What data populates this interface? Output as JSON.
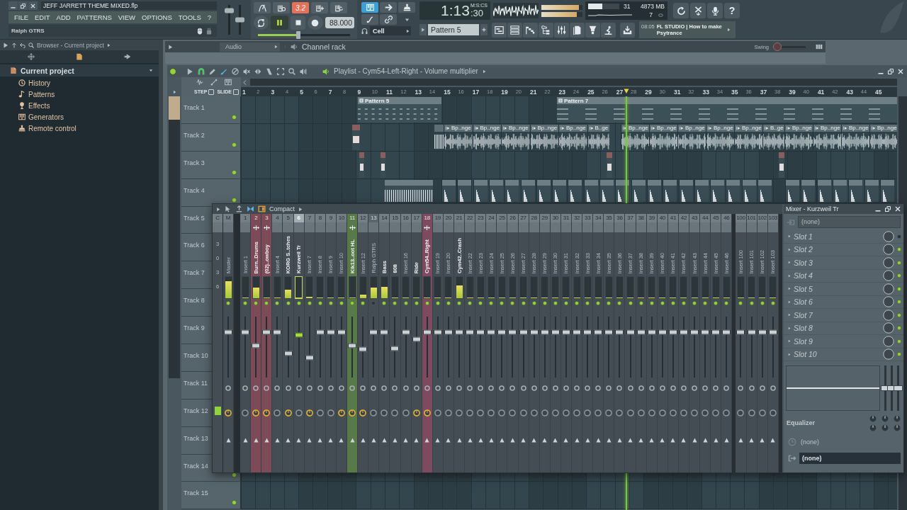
{
  "window": {
    "title": "JEFF JARRETT THEME MIXED.flp"
  },
  "menu": [
    "FILE",
    "EDIT",
    "ADD",
    "PATTERNS",
    "VIEW",
    "OPTIONS",
    "TOOLS",
    "?"
  ],
  "hint": "Ralph GTRS",
  "master_sliders": [
    {
      "level": 0.8
    },
    {
      "level": 0.5
    }
  ],
  "transport": {
    "toggles": [
      {
        "kind": "metronome",
        "on": false
      },
      {
        "kind": "wait",
        "on": false
      },
      {
        "kind": "countdown",
        "label": "3.2",
        "on": true
      },
      {
        "kind": "step",
        "on": false
      },
      {
        "kind": "blend",
        "on": false
      }
    ],
    "playing": true,
    "recording": false,
    "tempo": "88.000",
    "position": {
      "level": 0.44
    }
  },
  "recording_tools": [
    {
      "kind": "keyboard",
      "on": true
    },
    {
      "kind": "arrow",
      "on": false
    },
    {
      "kind": "stamp",
      "on": false
    },
    {
      "kind": "curve",
      "on": false
    },
    {
      "kind": "link",
      "on": false
    }
  ],
  "snap": "Cell",
  "time": {
    "main": "1:13",
    "fraction": ":30",
    "unit": "M:S:CS"
  },
  "output_meters": [
    {
      "level": 0.92
    },
    {
      "level": 0.86
    }
  ],
  "cpu": {
    "level": 0.45,
    "reading": "31",
    "memory": "4873 MB",
    "polyphony": "7"
  },
  "help_label": "?",
  "pattern": "Pattern 5",
  "news": {
    "time": "08:05",
    "title": "FL STUDIO | How to make Psytrance"
  },
  "browser": {
    "title": "Browser - Current project",
    "tree": [
      {
        "label": "Current project",
        "expanded": true,
        "children": [
          {
            "label": "History"
          },
          {
            "label": "Patterns"
          },
          {
            "label": "Effects"
          },
          {
            "label": "Generators"
          },
          {
            "label": "Remote control"
          }
        ]
      }
    ]
  },
  "channel_rack": {
    "filter": "Audio",
    "title": "Channel rack",
    "swing": {
      "label": "Swing",
      "level": 0.05
    }
  },
  "playlist": {
    "title": "Playlist - Cym54-Left-Right - Volume multiplier",
    "step": {
      "label": "STEP",
      "checked": false
    },
    "slide": {
      "label": "SLIDE",
      "checked": false
    },
    "bars": [
      "1",
      "2",
      "3",
      "4",
      "5",
      "6",
      "7",
      "8",
      "9",
      "10",
      "11",
      "12",
      "13",
      "14",
      "15",
      "16",
      "17",
      "18",
      "19",
      "20",
      "21",
      "22",
      "23",
      "24",
      "25",
      "26",
      "27",
      "28",
      "29",
      "30",
      "31",
      "32",
      "33",
      "34",
      "35",
      "36",
      "37",
      "38",
      "39",
      "40",
      "41",
      "42",
      "43",
      "44",
      "45"
    ],
    "tracks": [
      {
        "name": "Track 1",
        "clips": [
          {
            "kind": "pattern",
            "label": "Pattern 5"
          },
          {
            "kind": "pattern",
            "label": "Pattern 7"
          }
        ]
      },
      {
        "name": "Track 2",
        "clips": [
          {
            "kind": "audio",
            "label": "Bp..nge"
          },
          {
            "kind": "audio",
            "label": "Bp..nge"
          },
          {
            "kind": "audio",
            "label": "Bp..nge"
          },
          {
            "kind": "audio",
            "label": "Bp..nge"
          },
          {
            "kind": "audio",
            "label": "Bp..nge"
          },
          {
            "kind": "audio",
            "label": "B..ge"
          },
          {
            "kind": "audio",
            "label": "Bp..nge"
          },
          {
            "kind": "audio",
            "label": "Bp..nge"
          },
          {
            "kind": "audio",
            "label": "Bp..nge"
          },
          {
            "kind": "audio",
            "label": "Bp..nge"
          },
          {
            "kind": "audio",
            "label": "Bp..nge"
          },
          {
            "kind": "audio",
            "label": "B..ge"
          },
          {
            "kind": "audio",
            "label": "Bp..nge"
          },
          {
            "kind": "audio",
            "label": "Bp..nge"
          },
          {
            "kind": "audio",
            "label": "Bp..nge"
          },
          {
            "kind": "audio",
            "label": "Bp..nge"
          }
        ]
      },
      {
        "name": "Track 3"
      },
      {
        "name": "Track 4"
      },
      {
        "name": "Track 5"
      },
      {
        "name": "Track 6"
      },
      {
        "name": "Track 7"
      },
      {
        "name": "Track 8"
      },
      {
        "name": "Track 9"
      },
      {
        "name": "Track 10"
      },
      {
        "name": "Track 11"
      },
      {
        "name": "Track 12"
      },
      {
        "name": "Track 13"
      },
      {
        "name": "Track 14"
      },
      {
        "name": "Track 15"
      }
    ]
  },
  "mixer": {
    "view": "Compact",
    "title": "Mixer - Kurzweil Tr",
    "current_label": "C",
    "scale": [
      "3",
      "0",
      "3",
      "6"
    ],
    "channels": [
      {
        "number": "M",
        "name": "Master",
        "dimmed": true,
        "selected": false,
        "muted": false,
        "routed": false,
        "send": true,
        "level": 0.8,
        "fader": {
          "level": 0.75
        }
      },
      {
        "number": "1",
        "name": "Insert 1",
        "dimmed": true,
        "selected": false,
        "muted": false,
        "routed": false,
        "send": false,
        "level": 0,
        "fader": {
          "level": 0.75
        }
      },
      {
        "number": "2",
        "name": "Burn..Drums",
        "dimmed": false,
        "selected": false,
        "muted": false,
        "routed": true,
        "send": true,
        "level": 0.5,
        "fader": {
          "level": 0.52
        },
        "color": "#7d4a58"
      },
      {
        "number": "3",
        "name": "(02)..owboy",
        "dimmed": false,
        "selected": false,
        "muted": false,
        "routed": true,
        "send": true,
        "level": 0,
        "fader": {
          "level": 0.75
        },
        "color": "#7d4a58"
      },
      {
        "number": "4",
        "name": "Insert 4",
        "dimmed": true,
        "selected": false,
        "muted": false,
        "routed": false,
        "send": false,
        "level": 0,
        "fader": {
          "level": 0.75
        }
      },
      {
        "number": "5",
        "name": "KORG S..tches",
        "dimmed": false,
        "selected": false,
        "muted": false,
        "routed": false,
        "send": true,
        "level": 0.4,
        "fader": {
          "level": 0.4
        }
      },
      {
        "number": "6",
        "name": "Kurzweil Tr",
        "dimmed": false,
        "selected": true,
        "muted": false,
        "routed": false,
        "send": false,
        "level": 0,
        "fader": {
          "level": 0.7
        }
      },
      {
        "number": "7",
        "name": "Insert 7",
        "dimmed": true,
        "selected": false,
        "muted": false,
        "routed": false,
        "send": true,
        "level": 0.08,
        "fader": {
          "level": 0.33
        }
      },
      {
        "number": "8",
        "name": "Insert 8",
        "dimmed": true,
        "selected": false,
        "muted": false,
        "routed": false,
        "send": false,
        "level": 0,
        "fader": {
          "level": 0.75
        }
      },
      {
        "number": "9",
        "name": "Insert 9",
        "dimmed": true,
        "selected": false,
        "muted": false,
        "routed": false,
        "send": false,
        "level": 0,
        "fader": {
          "level": 0.75
        }
      },
      {
        "number": "10",
        "name": "Insert 10",
        "dimmed": true,
        "selected": false,
        "muted": false,
        "routed": false,
        "send": true,
        "level": 0,
        "fader": {
          "level": 0.75
        }
      },
      {
        "number": "11",
        "name": "Kik13..oot HL",
        "dimmed": false,
        "selected": false,
        "muted": false,
        "routed": true,
        "send": true,
        "level": 0,
        "fader": {
          "level": 0.52
        },
        "color": "#587a48"
      },
      {
        "number": "12",
        "name": "Insert 12",
        "dimmed": true,
        "selected": false,
        "muted": false,
        "routed": false,
        "send": true,
        "level": 0.18,
        "fader": {
          "level": 0.46
        }
      },
      {
        "number": "13",
        "name": "Ralph GTRS",
        "dimmed": true,
        "selected": false,
        "muted": true,
        "routed": false,
        "send": false,
        "level": 0.5,
        "fader": {
          "level": 0.75
        }
      },
      {
        "number": "14",
        "name": "Bass",
        "dimmed": false,
        "selected": false,
        "muted": false,
        "routed": false,
        "send": false,
        "level": 0.55,
        "fader": {
          "level": 0.75
        }
      },
      {
        "number": "15",
        "name": "808",
        "dimmed": false,
        "selected": false,
        "muted": false,
        "routed": false,
        "send": false,
        "level": 0,
        "fader": {
          "level": 0.48
        }
      },
      {
        "number": "16",
        "name": "Insert 16",
        "dimmed": true,
        "selected": false,
        "muted": false,
        "routed": false,
        "send": false,
        "level": 0,
        "fader": {
          "level": 0.75
        }
      },
      {
        "number": "17",
        "name": "Ride",
        "dimmed": false,
        "selected": false,
        "muted": false,
        "routed": false,
        "send": true,
        "level": 0,
        "fader": {
          "level": 0.63
        }
      },
      {
        "number": "18",
        "name": "Cym54..Right",
        "dimmed": false,
        "selected": false,
        "muted": false,
        "routed": true,
        "send": true,
        "level": 0,
        "fader": {
          "level": 0.75
        },
        "color": "#7e4a60"
      },
      {
        "number": "19",
        "name": "Insert 19",
        "dimmed": true,
        "selected": false,
        "muted": false,
        "routed": false,
        "send": false,
        "level": 0,
        "fader": {
          "level": 0.75
        }
      },
      {
        "number": "20",
        "name": "Insert 20",
        "dimmed": true,
        "selected": false,
        "muted": false,
        "routed": false,
        "send": false,
        "level": 0,
        "fader": {
          "level": 0.75
        }
      },
      {
        "number": "21",
        "name": "Cym42..Crash",
        "dimmed": false,
        "selected": false,
        "muted": false,
        "routed": false,
        "send": false,
        "level": 0.6,
        "fader": {
          "level": 0.75
        }
      },
      {
        "number": "22",
        "name": "Insert 22",
        "dimmed": true,
        "selected": false,
        "muted": false,
        "routed": false,
        "send": false,
        "level": 0,
        "fader": {
          "level": 0.75
        }
      },
      {
        "number": "23",
        "name": "Insert 23",
        "dimmed": true,
        "selected": false,
        "muted": false,
        "routed": false,
        "send": false,
        "level": 0,
        "fader": {
          "level": 0.75
        }
      },
      {
        "number": "24",
        "name": "Insert 24",
        "dimmed": true,
        "selected": false,
        "muted": false,
        "routed": false,
        "send": false,
        "level": 0,
        "fader": {
          "level": 0.75
        }
      },
      {
        "number": "25",
        "name": "Insert 25",
        "dimmed": true,
        "selected": false,
        "muted": false,
        "routed": false,
        "send": false,
        "level": 0,
        "fader": {
          "level": 0.75
        }
      },
      {
        "number": "26",
        "name": "Insert 26",
        "dimmed": true,
        "selected": false,
        "muted": false,
        "routed": false,
        "send": false,
        "level": 0,
        "fader": {
          "level": 0.75
        }
      },
      {
        "number": "27",
        "name": "Insert 27",
        "dimmed": true,
        "selected": false,
        "muted": false,
        "routed": false,
        "send": false,
        "level": 0,
        "fader": {
          "level": 0.75
        }
      },
      {
        "number": "28",
        "name": "Insert 28",
        "dimmed": true,
        "selected": false,
        "muted": false,
        "routed": false,
        "send": false,
        "level": 0,
        "fader": {
          "level": 0.75
        }
      },
      {
        "number": "29",
        "name": "Insert 29",
        "dimmed": true,
        "selected": false,
        "muted": false,
        "routed": false,
        "send": false,
        "level": 0,
        "fader": {
          "level": 0.75
        }
      },
      {
        "number": "30",
        "name": "Insert 30",
        "dimmed": true,
        "selected": false,
        "muted": false,
        "routed": false,
        "send": false,
        "level": 0,
        "fader": {
          "level": 0.75
        }
      },
      {
        "number": "31",
        "name": "Insert 31",
        "dimmed": true,
        "selected": false,
        "muted": false,
        "routed": false,
        "send": false,
        "level": 0,
        "fader": {
          "level": 0.75
        }
      },
      {
        "number": "32",
        "name": "Insert 32",
        "dimmed": true,
        "selected": false,
        "muted": false,
        "routed": false,
        "send": false,
        "level": 0,
        "fader": {
          "level": 0.75
        }
      },
      {
        "number": "33",
        "name": "Insert 33",
        "dimmed": true,
        "selected": false,
        "muted": false,
        "routed": false,
        "send": false,
        "level": 0,
        "fader": {
          "level": 0.75
        }
      },
      {
        "number": "34",
        "name": "Insert 34",
        "dimmed": true,
        "selected": false,
        "muted": false,
        "routed": false,
        "send": false,
        "level": 0,
        "fader": {
          "level": 0.75
        }
      },
      {
        "number": "35",
        "name": "Insert 35",
        "dimmed": true,
        "selected": false,
        "muted": false,
        "routed": false,
        "send": false,
        "level": 0,
        "fader": {
          "level": 0.75
        }
      },
      {
        "number": "36",
        "name": "Insert 36",
        "dimmed": true,
        "selected": false,
        "muted": false,
        "routed": false,
        "send": false,
        "level": 0,
        "fader": {
          "level": 0.75
        }
      },
      {
        "number": "37",
        "name": "Insert 37",
        "dimmed": true,
        "selected": false,
        "muted": false,
        "routed": false,
        "send": false,
        "level": 0,
        "fader": {
          "level": 0.75
        }
      },
      {
        "number": "38",
        "name": "Insert 38",
        "dimmed": true,
        "selected": false,
        "muted": false,
        "routed": false,
        "send": false,
        "level": 0,
        "fader": {
          "level": 0.75
        }
      },
      {
        "number": "39",
        "name": "Insert 39",
        "dimmed": true,
        "selected": false,
        "muted": false,
        "routed": false,
        "send": false,
        "level": 0,
        "fader": {
          "level": 0.75
        }
      },
      {
        "number": "40",
        "name": "Insert 40",
        "dimmed": true,
        "selected": false,
        "muted": false,
        "routed": false,
        "send": false,
        "level": 0,
        "fader": {
          "level": 0.75
        }
      },
      {
        "number": "41",
        "name": "Insert 41",
        "dimmed": true,
        "selected": false,
        "muted": false,
        "routed": false,
        "send": false,
        "level": 0,
        "fader": {
          "level": 0.75
        }
      },
      {
        "number": "42",
        "name": "Insert 42",
        "dimmed": true,
        "selected": false,
        "muted": false,
        "routed": false,
        "send": false,
        "level": 0,
        "fader": {
          "level": 0.75
        }
      },
      {
        "number": "43",
        "name": "Insert 43",
        "dimmed": true,
        "selected": false,
        "muted": false,
        "routed": false,
        "send": false,
        "level": 0,
        "fader": {
          "level": 0.75
        }
      },
      {
        "number": "44",
        "name": "Insert 44",
        "dimmed": true,
        "selected": false,
        "muted": false,
        "routed": false,
        "send": false,
        "level": 0,
        "fader": {
          "level": 0.75
        }
      },
      {
        "number": "45",
        "name": "Insert 45",
        "dimmed": true,
        "selected": false,
        "muted": false,
        "routed": false,
        "send": false,
        "level": 0,
        "fader": {
          "level": 0.75
        }
      },
      {
        "number": "46",
        "name": "Insert 46",
        "dimmed": true,
        "selected": false,
        "muted": false,
        "routed": false,
        "send": false,
        "level": 0,
        "fader": {
          "level": 0.75
        }
      },
      {
        "number": "100",
        "name": "Insert 100",
        "dimmed": true,
        "selected": false,
        "muted": false,
        "routed": false,
        "send": false,
        "level": 0,
        "fader": {
          "level": 0.75
        }
      },
      {
        "number": "101",
        "name": "Insert 101",
        "dimmed": true,
        "selected": false,
        "muted": false,
        "routed": false,
        "send": false,
        "level": 0,
        "fader": {
          "level": 0.75
        }
      },
      {
        "number": "102",
        "name": "Insert 102",
        "dimmed": true,
        "selected": false,
        "muted": false,
        "routed": false,
        "send": false,
        "level": 0,
        "fader": {
          "level": 0.75
        }
      },
      {
        "number": "103",
        "name": "Insert 103",
        "dimmed": true,
        "selected": false,
        "muted": false,
        "routed": false,
        "send": false,
        "level": 0,
        "fader": {
          "level": 0.75
        }
      }
    ],
    "input": "(none)",
    "slots": [
      {
        "label": "Slot 1",
        "on": false
      },
      {
        "label": "Slot 2",
        "on": true
      },
      {
        "label": "Slot 3",
        "on": true
      },
      {
        "label": "Slot 4",
        "on": true
      },
      {
        "label": "Slot 5",
        "on": true
      },
      {
        "label": "Slot 6",
        "on": true
      },
      {
        "label": "Slot 7",
        "on": true
      },
      {
        "label": "Slot 8",
        "on": true
      },
      {
        "label": "Slot 9",
        "on": true
      },
      {
        "label": "Slot 10",
        "on": true
      }
    ],
    "eq": {
      "label": "Equalizer",
      "bands": [
        {
          "level": 0.5
        },
        {
          "level": 0.5
        },
        {
          "level": 0.5
        }
      ]
    },
    "latency": "(none)",
    "output": "(none)"
  }
}
